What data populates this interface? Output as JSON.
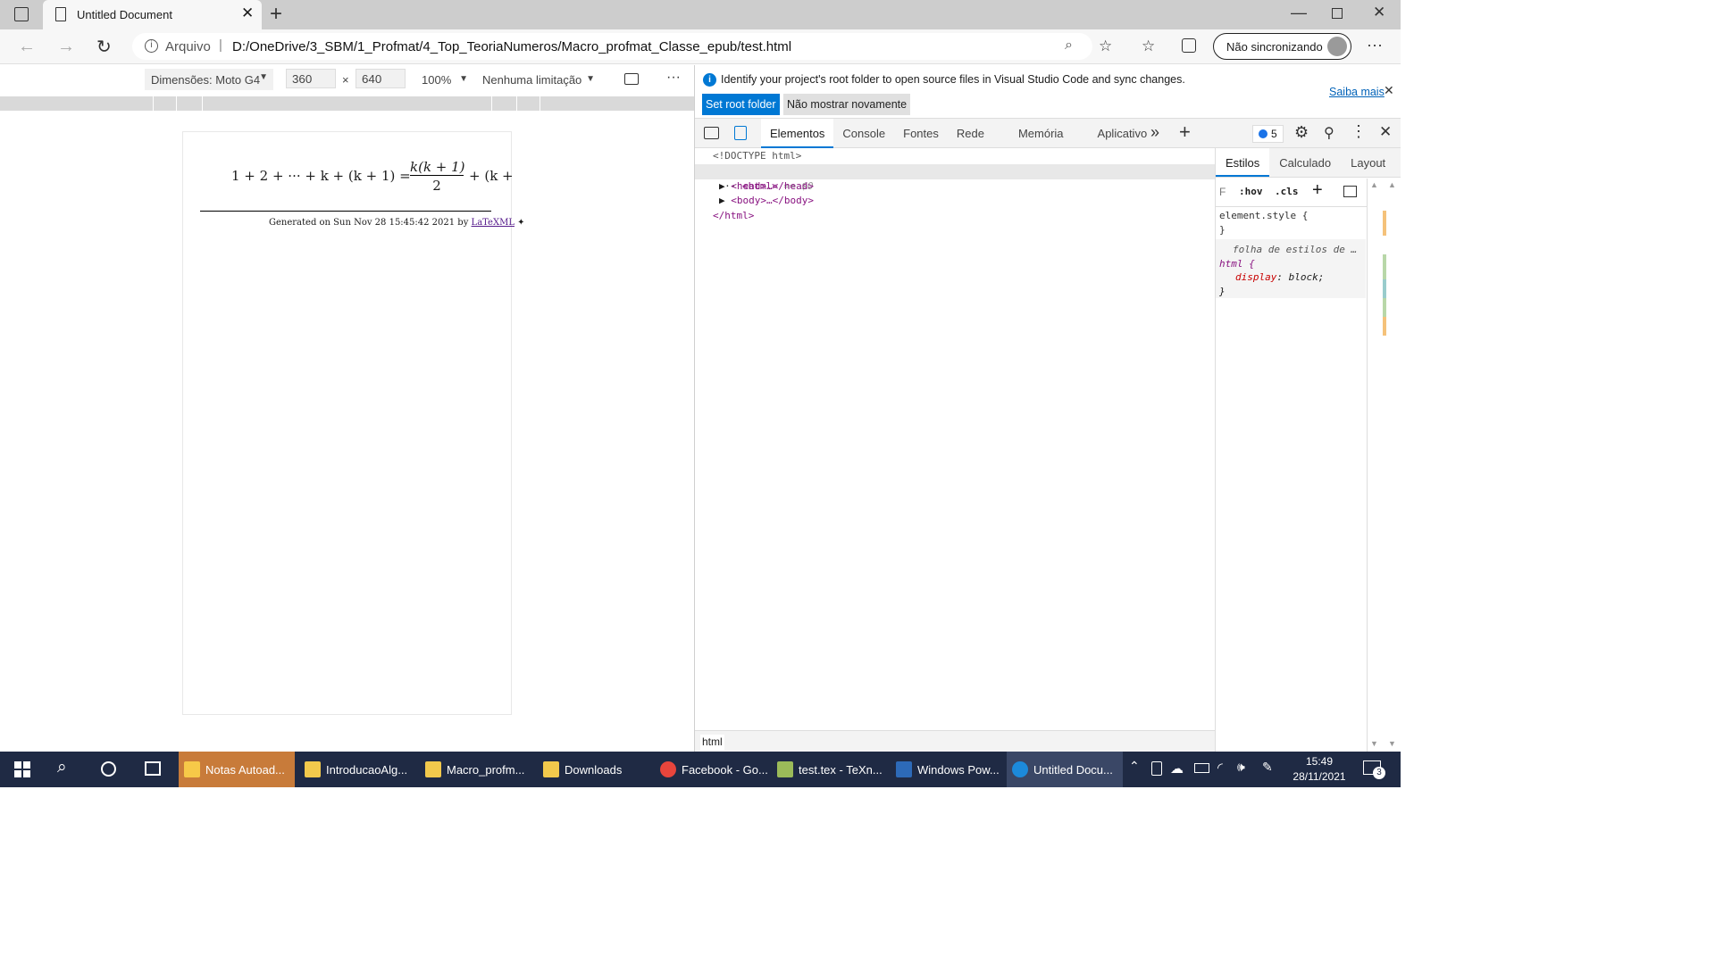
{
  "browser": {
    "tab_title": "Untitled Document",
    "address_prefix": "Arquivo",
    "address_url": "D:/OneDrive/3_SBM/1_Profmat/4_Top_TeoriaNumeros/Macro_profmat_Classe_epub/test.html",
    "sync_label": "Não sincronizando"
  },
  "device_toolbar": {
    "dimensions_label": "Dimensões: Moto G4",
    "width": "360",
    "height": "640",
    "times": "×",
    "zoom": "100%",
    "throttle": "Nenhuma limitação"
  },
  "page": {
    "formula_text": "1 + 2 + ··· + k + (k + 1) = k(k + 1)/2 + (k +",
    "formula_lhs": "1 + 2 + ··· + k + (k + 1) =",
    "formula_num": "k(k + 1)",
    "formula_den": "2",
    "formula_tail": "+ (k +",
    "footer_prefix": "Generated on Sun Nov 28 15:45:42 2021 by",
    "footer_link": "LaTeXML"
  },
  "devtools": {
    "info_message": "Identify your project's root folder to open source files in Visual Studio Code and sync changes.",
    "learn_more": "Saiba mais",
    "set_root_button": "Set root folder",
    "dont_show_button": "Não mostrar novamente",
    "tabs": [
      "Elementos",
      "Console",
      "Fontes",
      "Rede",
      "Memória",
      "Aplicativo"
    ],
    "issues_count": "5",
    "dom": {
      "doctype": "<!DOCTYPE html>",
      "html_open": "<html>",
      "selected_marker": "== $0",
      "head": "<head>…</head>",
      "body": "<body>…</body>",
      "html_close": "</html>"
    },
    "breadcrumb": "html",
    "styles_tabs": [
      "Estilos",
      "Calculado",
      "Layout"
    ],
    "filter_placeholder": "F",
    "hov": ":hov",
    "cls": ".cls",
    "element_style": "element.style {",
    "close_brace": "}",
    "ua_comment": "folha de estilos de …",
    "ua_selector": "html {",
    "ua_property": "display",
    "ua_value": "block;"
  },
  "taskbar": {
    "apps": [
      {
        "label": "Notas Autoad...",
        "color": "#f7c948"
      },
      {
        "label": "IntroducaoAlg...",
        "color": "#f2c94c"
      },
      {
        "label": "Macro_profm...",
        "color": "#f2c94c"
      },
      {
        "label": "Downloads",
        "color": "#f2c94c"
      },
      {
        "label": "Facebook - Go...",
        "color": "#e8453c"
      },
      {
        "label": "test.tex - TeXn...",
        "color": "#9bbb59"
      },
      {
        "label": "Windows Pow...",
        "color": "#2d6ab8"
      },
      {
        "label": "Untitled Docu...",
        "color": "#1c8adb"
      }
    ],
    "time": "15:49",
    "date": "28/11/2021",
    "notifications": "3"
  },
  "colors": {
    "accent": "#0078d4",
    "taskbar": "#1f2a44",
    "link": "#551a8b"
  }
}
